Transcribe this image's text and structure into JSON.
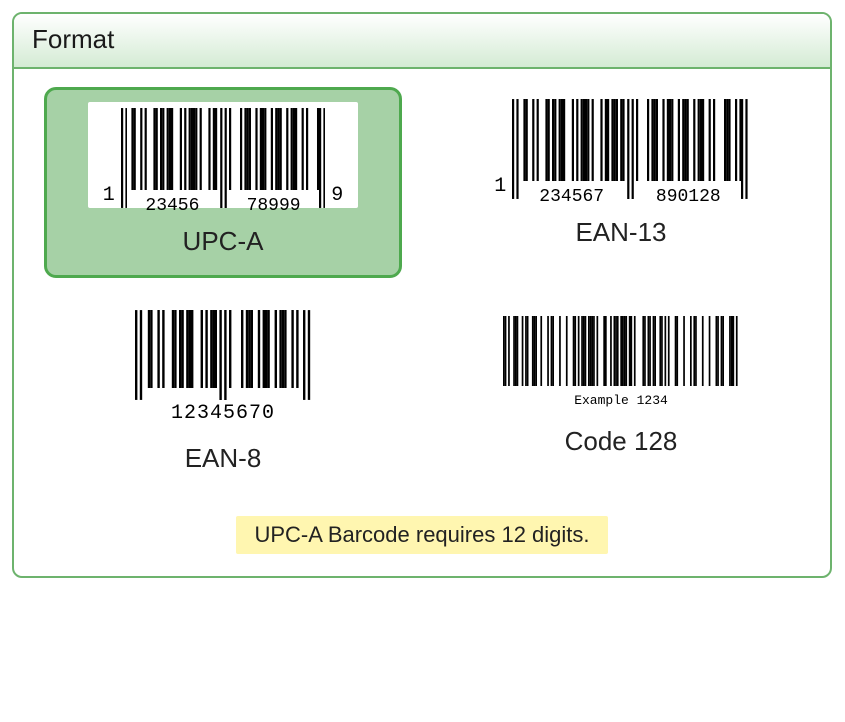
{
  "panel": {
    "title": "Format"
  },
  "options": {
    "upc_a": {
      "label": "UPC-A",
      "lead": "1",
      "group1": "23456",
      "group2": "78999",
      "trail": "9",
      "selected": true
    },
    "ean_13": {
      "label": "EAN-13",
      "lead": "1",
      "group1": "234567",
      "group2": "890128"
    },
    "ean_8": {
      "label": "EAN-8",
      "digits": "12345670"
    },
    "code_128": {
      "label": "Code 128",
      "text": "Example 1234"
    }
  },
  "note": {
    "text": "UPC-A Barcode requires 12 digits."
  },
  "barcode_patterns": {
    "upc_guard": "101",
    "upc_left5": "00110010100011011011100010101111010001011",
    "upc_center": "01010",
    "upc_right5": "10000101110010111001011100101110010100001",
    "ean13_left6": "001100101000110110111000101011110100010110111011",
    "ean13_right6": "100001011100101110010111001011100101000011100101",
    "ean8_left4": "0011001010001101101110001010111",
    "ean8_right4": "1000010111001011100101110010100",
    "code128": "1101001110010110011100100010110001000100011010111011110100011001011101111011010000110110110011010100011000100010110001000100011011000111010"
  }
}
